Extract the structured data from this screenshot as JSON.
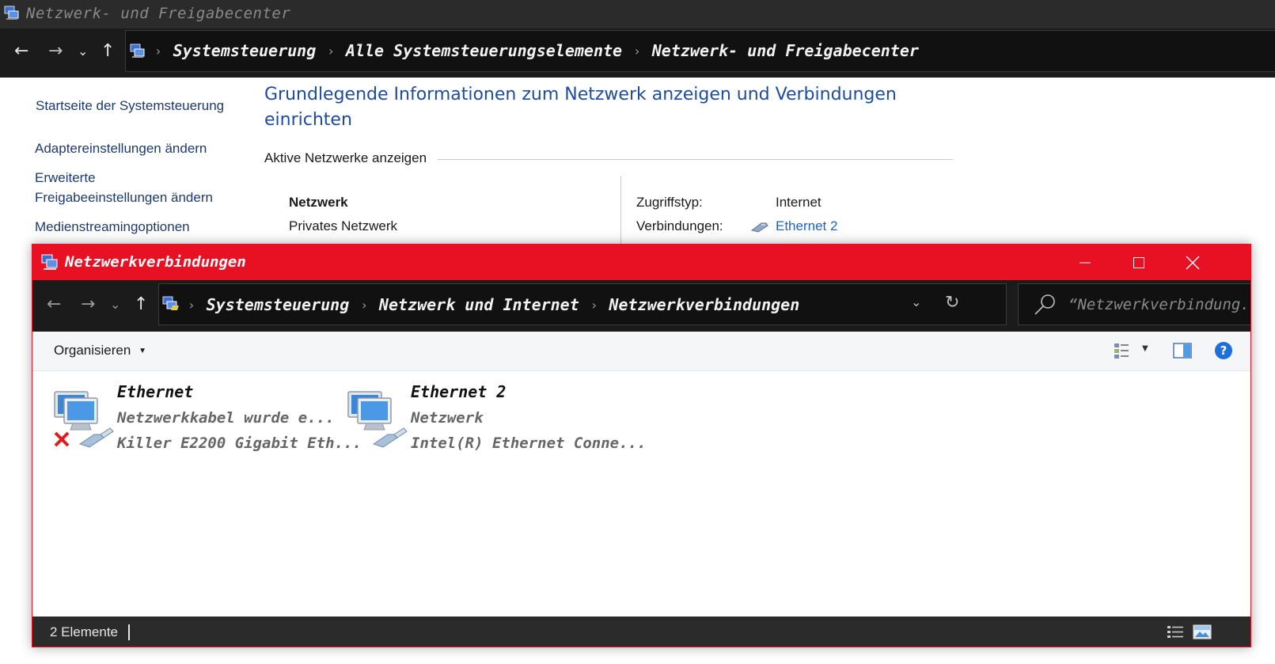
{
  "background_window": {
    "title": "Netzwerk- und Freigabecenter",
    "breadcrumbs": [
      "Systemsteuerung",
      "Alle Systemsteuerungselemente",
      "Netzwerk- und Freigabecenter"
    ],
    "sidebar": {
      "home": "Startseite der Systemsteuerung",
      "adapter": "Adaptereinstellungen ändern",
      "sharing_line1": "Erweiterte",
      "sharing_line2": "Freigabeeinstellungen ändern",
      "media": "Medienstreamingoptionen"
    },
    "heading": "Grundlegende Informationen zum Netzwerk anzeigen und Verbindungen einrichten",
    "active_networks_label": "Aktive Netzwerke anzeigen",
    "network": {
      "name": "Netzwerk",
      "type": "Privates Netzwerk",
      "access_label": "Zugriffstyp:",
      "access_value": "Internet",
      "connections_label": "Verbindungen:",
      "connections_value": "Ethernet 2"
    }
  },
  "foreground_window": {
    "title": "Netzwerkverbindungen",
    "breadcrumbs": [
      "Systemsteuerung",
      "Netzwerk und Internet",
      "Netzwerkverbindungen"
    ],
    "search_placeholder": "“Netzwerkverbindung...",
    "toolbar": {
      "organize": "Organisieren"
    },
    "items": [
      {
        "name": "Ethernet",
        "status": "Netzwerkkabel wurde e...",
        "device": "Killer E2200 Gigabit Eth...",
        "disconnected": true
      },
      {
        "name": "Ethernet 2",
        "status": "Netzwerk",
        "device": "Intel(R) Ethernet Conne...",
        "disconnected": false
      }
    ],
    "status_bar": {
      "count": "2 Elemente"
    }
  },
  "colors": {
    "accent_red": "#e81123",
    "dark_bar": "#1b1b1b",
    "link_blue": "#1e63c4",
    "heading_blue": "#1e4b9a"
  }
}
